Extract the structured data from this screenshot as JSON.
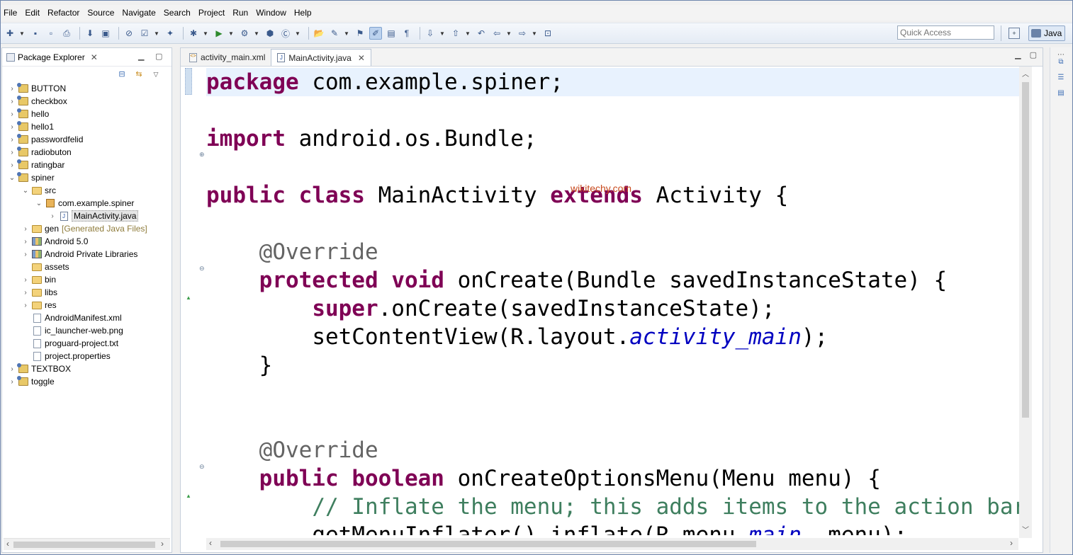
{
  "menubar": {
    "items": [
      "File",
      "Edit",
      "Refactor",
      "Source",
      "Navigate",
      "Search",
      "Project",
      "Run",
      "Window",
      "Help"
    ]
  },
  "toolbar": {
    "quick_access_placeholder": "Quick Access",
    "perspective_label": "Java"
  },
  "package_explorer": {
    "title": "Package Explorer",
    "tree": [
      {
        "label": "BUTTON",
        "level": 0,
        "twisty": ">",
        "icon": "project-icon"
      },
      {
        "label": "checkbox",
        "level": 0,
        "twisty": ">",
        "icon": "project-icon"
      },
      {
        "label": "hello",
        "level": 0,
        "twisty": ">",
        "icon": "project-icon"
      },
      {
        "label": "hello1",
        "level": 0,
        "twisty": ">",
        "icon": "project-icon"
      },
      {
        "label": "passwordfelid",
        "level": 0,
        "twisty": ">",
        "icon": "project-icon"
      },
      {
        "label": "radiobuton",
        "level": 0,
        "twisty": ">",
        "icon": "project-icon"
      },
      {
        "label": "ratingbar",
        "level": 0,
        "twisty": ">",
        "icon": "project-icon"
      },
      {
        "label": "spiner",
        "level": 0,
        "twisty": "v",
        "icon": "project-icon"
      },
      {
        "label": "src",
        "level": 1,
        "twisty": "v",
        "icon": "folder-icon"
      },
      {
        "label": "com.example.spiner",
        "level": 2,
        "twisty": "v",
        "icon": "package-icon"
      },
      {
        "label": "MainActivity.java",
        "level": 3,
        "twisty": ">",
        "icon": "java-file-icon",
        "selected": true
      },
      {
        "label": "gen",
        "decorator": "[Generated Java Files]",
        "level": 1,
        "twisty": ">",
        "icon": "folder-icon"
      },
      {
        "label": "Android 5.0",
        "level": 1,
        "twisty": ">",
        "icon": "library-icon"
      },
      {
        "label": "Android Private Libraries",
        "level": 1,
        "twisty": ">",
        "icon": "library-icon"
      },
      {
        "label": "assets",
        "level": 1,
        "twisty": "",
        "icon": "folder-icon"
      },
      {
        "label": "bin",
        "level": 1,
        "twisty": ">",
        "icon": "folder-icon"
      },
      {
        "label": "libs",
        "level": 1,
        "twisty": ">",
        "icon": "folder-icon"
      },
      {
        "label": "res",
        "level": 1,
        "twisty": ">",
        "icon": "folder-icon"
      },
      {
        "label": "AndroidManifest.xml",
        "level": 1,
        "twisty": "",
        "icon": "file-icon"
      },
      {
        "label": "ic_launcher-web.png",
        "level": 1,
        "twisty": "",
        "icon": "file-icon"
      },
      {
        "label": "proguard-project.txt",
        "level": 1,
        "twisty": "",
        "icon": "file-icon"
      },
      {
        "label": "project.properties",
        "level": 1,
        "twisty": "",
        "icon": "file-icon"
      },
      {
        "label": "TEXTBOX",
        "level": 0,
        "twisty": ">",
        "icon": "project-icon"
      },
      {
        "label": "toggle",
        "level": 0,
        "twisty": ">",
        "icon": "project-icon"
      }
    ]
  },
  "editor": {
    "tabs": [
      {
        "label": "activity_main.xml",
        "active": false
      },
      {
        "label": "MainActivity.java",
        "active": true
      }
    ],
    "watermark": "wikitechy.com",
    "code": {
      "l1_kw": "package",
      "l1_rest": " com.example.spiner;",
      "l2_kw": "import",
      "l2_rest": " android.os.Bundle;",
      "l3_kw1": "public",
      "l3_kw2": "class",
      "l3_mid": " MainActivity ",
      "l3_kw3": "extends",
      "l3_rest": " Activity {",
      "l4_ann": "@Override",
      "l5_kw1": "protected",
      "l5_kw2": "void",
      "l5_rest": " onCreate(Bundle savedInstanceState) {",
      "l6_kw": "super",
      "l6_rest": ".onCreate(savedInstanceState);",
      "l7_pre": "setContentView(R.layout.",
      "l7_field": "activity_main",
      "l7_post": ");",
      "l8": "}",
      "l9_ann": "@Override",
      "l10_kw1": "public",
      "l10_kw2": "boolean",
      "l10_rest": " onCreateOptionsMenu(Menu menu) {",
      "l11_comment": "// Inflate the menu; this adds items to the action bar if it is present.",
      "l12_pre": "getMenuInflater().inflate(R.menu.",
      "l12_field": "main",
      "l12_post": ", menu);"
    }
  }
}
